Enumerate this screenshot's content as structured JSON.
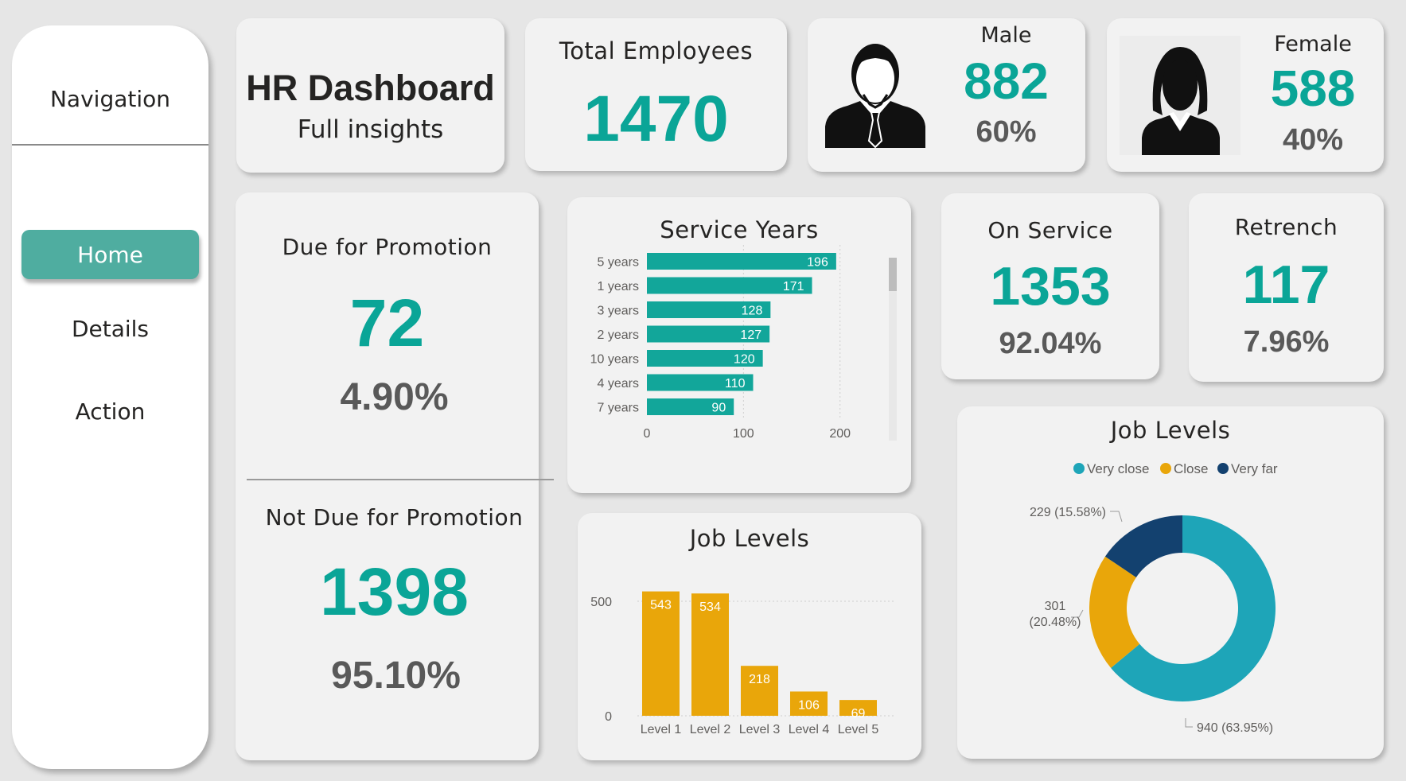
{
  "navigation": {
    "title": "Navigation",
    "items": [
      {
        "label": "Home",
        "active": true
      },
      {
        "label": "Details",
        "active": false
      },
      {
        "label": "Action",
        "active": false
      }
    ]
  },
  "header": {
    "title": "HR Dashboard",
    "subtitle": "Full insights"
  },
  "kpis": {
    "total": {
      "label": "Total Employees",
      "value": "1470"
    },
    "male": {
      "label": "Male",
      "value": "882",
      "pct": "60%",
      "icon": "male-avatar-icon"
    },
    "female": {
      "label": "Female",
      "value": "588",
      "pct": "40%",
      "icon": "female-avatar-icon"
    },
    "due_promotion": {
      "label": "Due for Promotion",
      "value": "72",
      "pct": "4.90%"
    },
    "not_due_promotion": {
      "label": "Not Due for Promotion",
      "value": "1398",
      "pct": "95.10%"
    },
    "on_service": {
      "label": "On Service",
      "value": "1353",
      "pct": "92.04%"
    },
    "retrench": {
      "label": "Retrench",
      "value": "117",
      "pct": "7.96%"
    }
  },
  "colors": {
    "teal": "#0aa597",
    "bar_teal": "#12a69a",
    "gold": "#e9a60a",
    "donut_teal": "#1ea5b8",
    "donut_gold": "#e9a60a",
    "donut_navy": "#13416f",
    "grey_text": "#595959"
  },
  "chart_data": [
    {
      "id": "service_years",
      "type": "bar",
      "orientation": "horizontal",
      "title": "Service Years",
      "categories": [
        "5 years",
        "1 years",
        "3 years",
        "2 years",
        "10 years",
        "4 years",
        "7 years"
      ],
      "values": [
        196,
        171,
        128,
        127,
        120,
        110,
        90
      ],
      "xlim": [
        0,
        220
      ],
      "xticks": [
        0,
        100,
        200
      ],
      "grid": true
    },
    {
      "id": "job_levels_bar",
      "type": "bar",
      "title": "Job Levels",
      "categories": [
        "Level 1",
        "Level 2",
        "Level 3",
        "Level 4",
        "Level 5"
      ],
      "values": [
        543,
        534,
        218,
        106,
        69
      ],
      "ylim": [
        0,
        600
      ],
      "yticks": [
        0,
        500
      ],
      "grid": true
    },
    {
      "id": "job_levels_donut",
      "type": "pie",
      "donut": true,
      "title": "Job Levels",
      "legend": "top",
      "series": [
        {
          "name": "Very close",
          "value": 940,
          "label": "940 (63.95%)"
        },
        {
          "name": "Close",
          "value": 301,
          "label_line1": "301",
          "label_line2": "(20.48%)"
        },
        {
          "name": "Very far",
          "value": 229,
          "label": "229 (15.58%)"
        }
      ]
    }
  ]
}
